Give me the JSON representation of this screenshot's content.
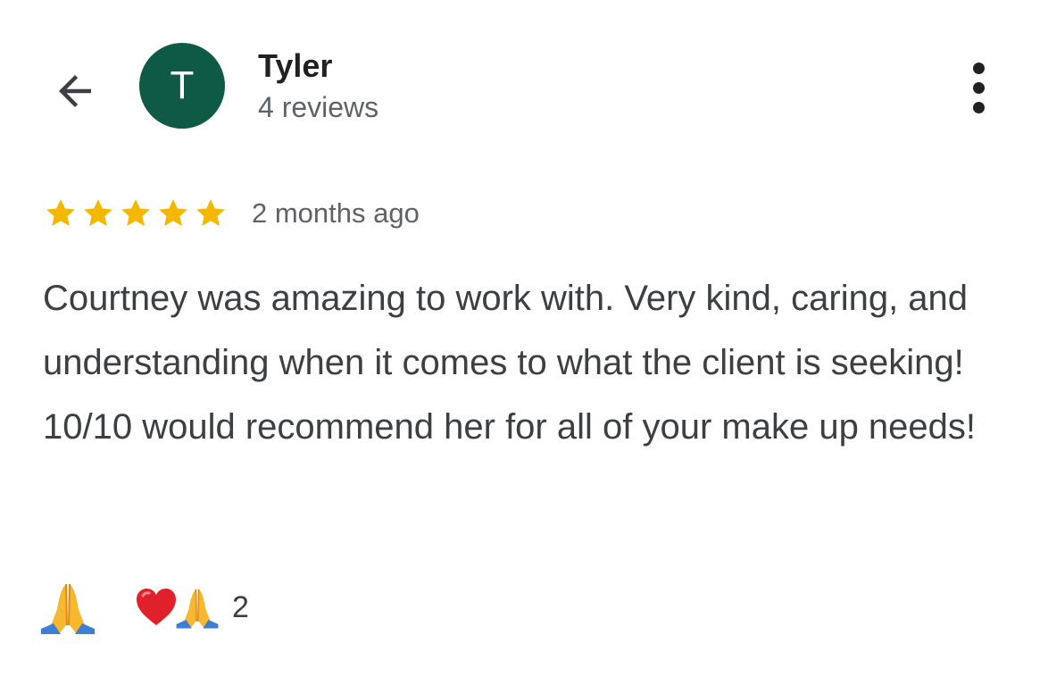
{
  "reviewer": {
    "name": "Tyler",
    "avatar_initial": "T",
    "review_count": "4 reviews",
    "avatar_color": "#0f5a45"
  },
  "header": {
    "back_icon": "arrow-back-icon",
    "more_icon": "more-vert-icon"
  },
  "review": {
    "rating": 5,
    "rating_max": 5,
    "star_color": "#f5b800",
    "date": "2 months ago",
    "text": "Courtney was amazing to work with. Very kind, caring, and understanding when it comes to what the client is seeking! 10/10 would recommend her for all of your make up needs!"
  },
  "reactions": {
    "react_icon": "folded-hands-emoji",
    "summary_icons": [
      "red-heart-emoji",
      "folded-hands-emoji"
    ],
    "count": "2"
  }
}
